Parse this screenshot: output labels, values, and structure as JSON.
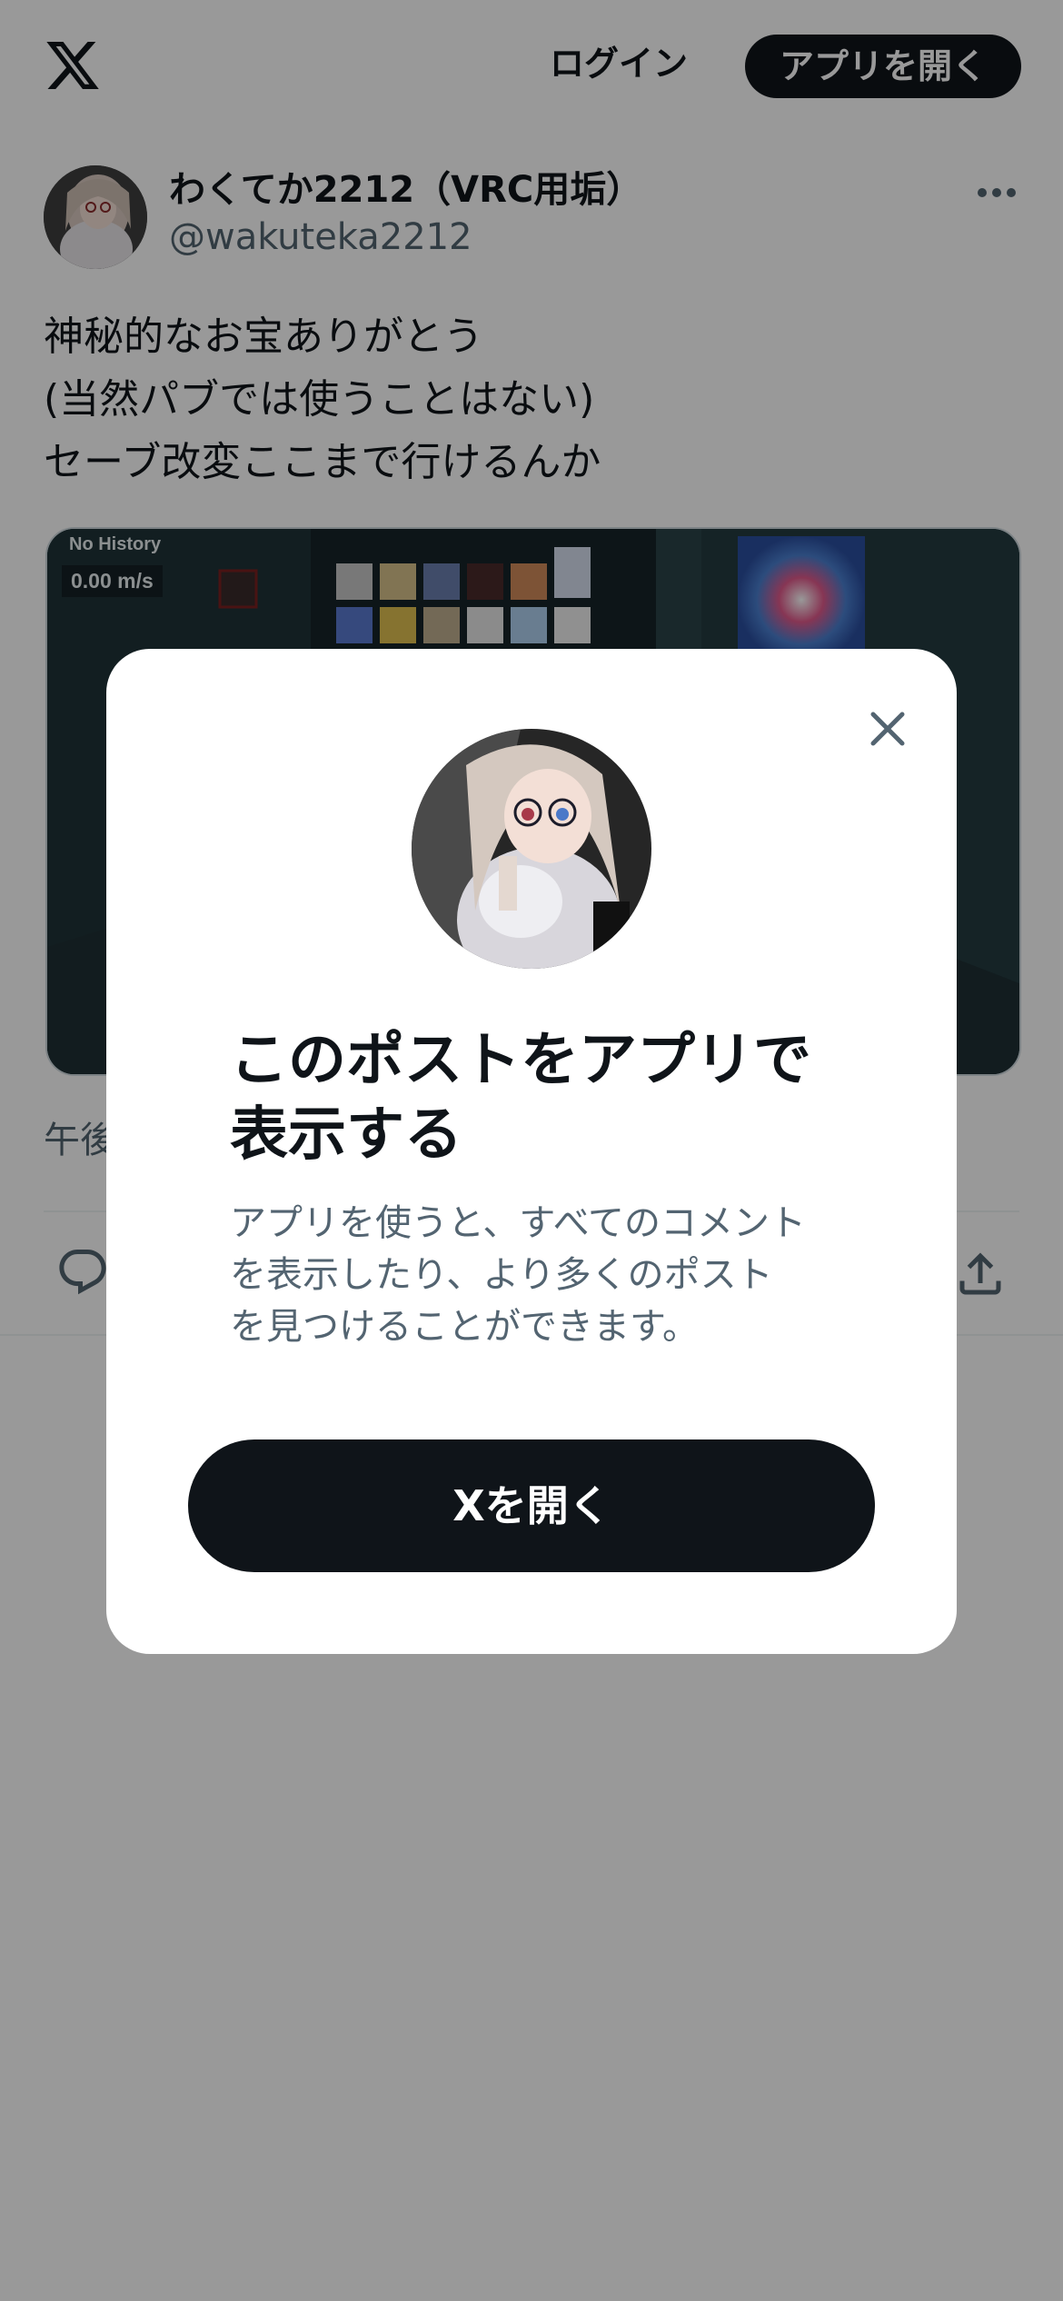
{
  "header": {
    "logo_icon": "x-logo-icon",
    "login_label": "ログイン",
    "open_app_label": "アプリを開く"
  },
  "post": {
    "author_name": "わくてか2212（VRC用垢）",
    "author_handle": "@wakuteka2212",
    "more_icon": "more-horizontal-icon",
    "text_lines": [
      "神秘的なお宝ありがとう",
      "(当然パブでは使うことはない)",
      "セーブ改変ここまで行けるんか"
    ],
    "media": {
      "overlay_label": "No History",
      "speed_readout": "0.00 m/s"
    },
    "timestamp_visible": "午後",
    "actions": {
      "reply_icon": "reply-icon",
      "share_icon": "share-icon"
    }
  },
  "modal": {
    "close_icon": "close-icon",
    "title_lines": [
      "このポストをアプリで",
      "表示する"
    ],
    "description_lines": [
      "アプリを使うと、すべてのコメント",
      "を表示したり、より多くのポスト",
      "を見つけることができます。"
    ],
    "open_x_label": "Xを開く"
  },
  "colors": {
    "text_primary": "#0f1419",
    "text_secondary": "#536471",
    "button_dark": "#0f1419",
    "overlay": "rgba(0,0,0,0.4)"
  }
}
